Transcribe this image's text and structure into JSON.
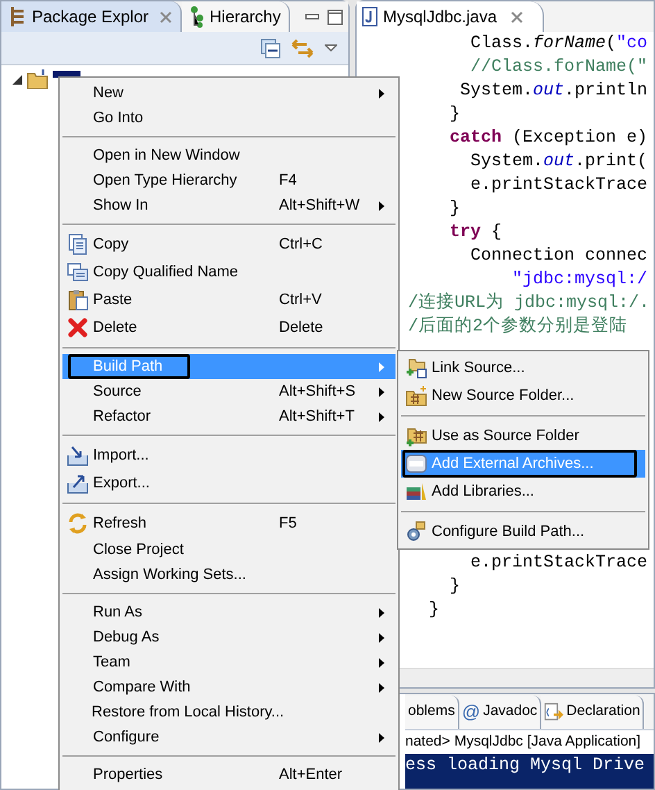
{
  "left_view": {
    "tabs": [
      {
        "label": "Package Explor",
        "selected": true,
        "closable": true
      },
      {
        "label": "Hierarchy",
        "selected": false
      }
    ]
  },
  "context_menu": {
    "items": [
      {
        "kind": "item",
        "label": "New",
        "submenu": true,
        "selected": false
      },
      {
        "kind": "item",
        "label": "Go Into",
        "selected": false
      },
      {
        "kind": "separator"
      },
      {
        "kind": "item",
        "label": "Open in New Window",
        "selected": false
      },
      {
        "kind": "item",
        "label": "Open Type Hierarchy",
        "shortcut": "F4",
        "selected": false
      },
      {
        "kind": "item",
        "label": "Show In",
        "shortcut": "Alt+Shift+W",
        "submenu": true,
        "selected": false
      },
      {
        "kind": "separator"
      },
      {
        "kind": "item",
        "label": "Copy",
        "shortcut": "Ctrl+C",
        "selected": false
      },
      {
        "kind": "item",
        "label": "Copy Qualified Name",
        "selected": false
      },
      {
        "kind": "item",
        "label": "Paste",
        "shortcut": "Ctrl+V",
        "selected": false
      },
      {
        "kind": "item",
        "label": "Delete",
        "shortcut": "Delete",
        "selected": false
      },
      {
        "kind": "separator"
      },
      {
        "kind": "item",
        "label": "Build Path",
        "submenu": true,
        "selected": true
      },
      {
        "kind": "item",
        "label": "Source",
        "shortcut": "Alt+Shift+S",
        "submenu": true,
        "selected": false
      },
      {
        "kind": "item",
        "label": "Refactor",
        "shortcut": "Alt+Shift+T",
        "submenu": true,
        "selected": false
      },
      {
        "kind": "separator"
      },
      {
        "kind": "item",
        "label": "Import...",
        "selected": false
      },
      {
        "kind": "item",
        "label": "Export...",
        "selected": false
      },
      {
        "kind": "separator"
      },
      {
        "kind": "item",
        "label": "Refresh",
        "shortcut": "F5",
        "selected": false
      },
      {
        "kind": "item",
        "label": "Close Project",
        "selected": false
      },
      {
        "kind": "item",
        "label": "Assign Working Sets...",
        "selected": false
      },
      {
        "kind": "separator"
      },
      {
        "kind": "item",
        "label": "Run As",
        "submenu": true,
        "selected": false
      },
      {
        "kind": "item",
        "label": "Debug As",
        "submenu": true,
        "selected": false
      },
      {
        "kind": "item",
        "label": "Team",
        "submenu": true,
        "selected": false
      },
      {
        "kind": "item",
        "label": "Compare With",
        "submenu": true,
        "selected": false
      },
      {
        "kind": "item",
        "label": "Restore from Local History...",
        "selected": false
      },
      {
        "kind": "item",
        "label": "Configure",
        "submenu": true,
        "selected": false
      },
      {
        "kind": "separator"
      },
      {
        "kind": "item",
        "label": "Properties",
        "shortcut": "Alt+Enter",
        "selected": false
      }
    ]
  },
  "submenu": {
    "items": [
      {
        "kind": "item",
        "label": "Link Source...",
        "selected": false
      },
      {
        "kind": "item",
        "label": "New Source Folder...",
        "selected": false
      },
      {
        "kind": "separator"
      },
      {
        "kind": "item",
        "label": "Use as Source Folder",
        "selected": false
      },
      {
        "kind": "item",
        "label": "Add External Archives...",
        "selected": true
      },
      {
        "kind": "item",
        "label": "Add Libraries...",
        "selected": false
      },
      {
        "kind": "separator"
      },
      {
        "kind": "item",
        "label": "Configure Build Path...",
        "selected": false
      }
    ]
  },
  "editor": {
    "tab": {
      "label": "MysqlJdbc.java",
      "closable": true
    },
    "code_top": [
      [
        {
          "t": "      Class.",
          "kind": "plain"
        },
        {
          "t": "forName",
          "kind": "static"
        },
        {
          "t": "(",
          "kind": "plain"
        },
        {
          "t": "\"co",
          "kind": "string"
        }
      ],
      [
        {
          "t": "      //Class.forName(\"",
          "kind": "comment"
        }
      ],
      [
        {
          "t": "     System.",
          "kind": "plain"
        },
        {
          "t": "out",
          "kind": "field"
        },
        {
          "t": ".println",
          "kind": "plain"
        }
      ],
      [
        {
          "t": "    }",
          "kind": "plain"
        }
      ],
      [
        {
          "t": "    catch",
          "kind": "keyword"
        },
        {
          "t": " (Exception e)",
          "kind": "plain"
        }
      ],
      [
        {
          "t": "      System.",
          "kind": "plain"
        },
        {
          "t": "out",
          "kind": "field"
        },
        {
          "t": ".print(",
          "kind": "plain"
        }
      ],
      [
        {
          "t": "      e.printStackTrace",
          "kind": "plain"
        }
      ],
      [
        {
          "t": "    }",
          "kind": "plain"
        }
      ],
      [
        {
          "t": "    try",
          "kind": "keyword"
        },
        {
          "t": " {",
          "kind": "plain"
        }
      ],
      [
        {
          "t": "      Connection connec",
          "kind": "plain"
        }
      ],
      [
        {
          "t": "          \"jdbc:mysql:/",
          "kind": "string"
        }
      ],
      [
        {
          "t": "/连接URL为 jdbc:mysql:/.",
          "kind": "comment"
        }
      ],
      [
        {
          "t": "/后面的2个参数分别是登陆",
          "kind": "comment"
        }
      ]
    ],
    "code_bottom": [
      [
        {
          "t": "      e.printStackTrace",
          "kind": "plain"
        }
      ],
      [
        {
          "t": "    }",
          "kind": "plain"
        }
      ],
      [
        {
          "t": "  }",
          "kind": "plain"
        }
      ]
    ]
  },
  "bottom_view": {
    "tabs": [
      {
        "label": "oblems",
        "selected": false
      },
      {
        "label": "Javadoc",
        "glyph": "@",
        "selected": false
      },
      {
        "label": "Declaration",
        "selected": false
      }
    ],
    "header": "nated> MysqlJdbc [Java Application]",
    "console_lines": [
      "ess loading Mysql Drive"
    ]
  }
}
